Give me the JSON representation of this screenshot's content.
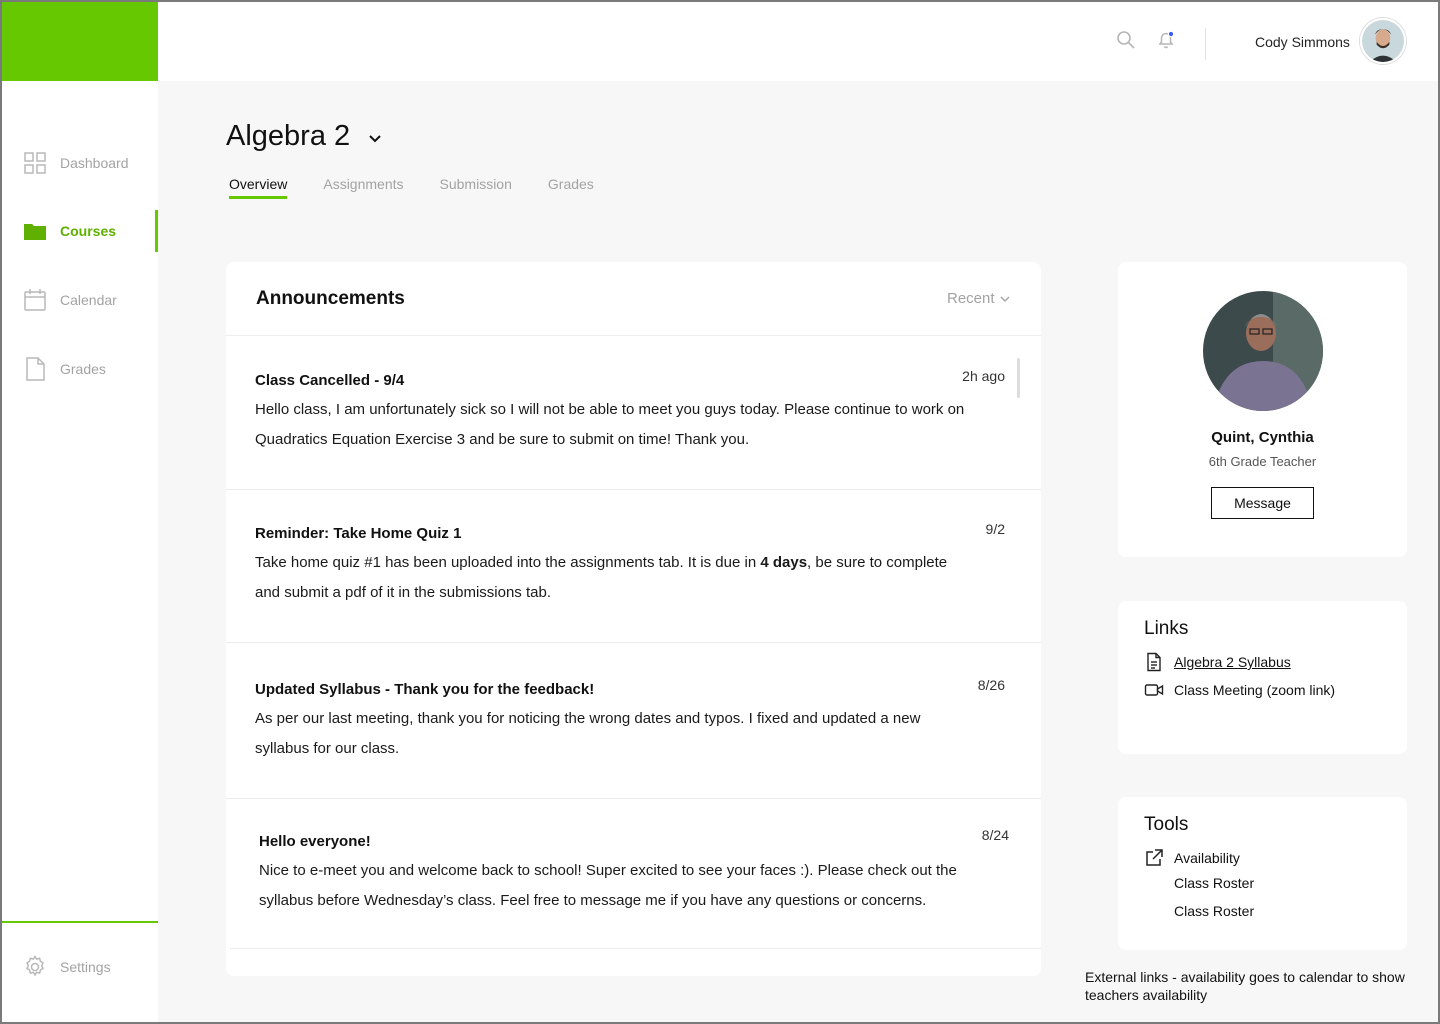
{
  "colors": {
    "accent": "#66c800",
    "active_text": "#5fb000",
    "notification_dot": "#3a5bff"
  },
  "sidebar": {
    "items": [
      {
        "label": "Dashboard",
        "icon": "grid-icon",
        "active": false
      },
      {
        "label": "Courses",
        "icon": "folder-icon",
        "active": true
      },
      {
        "label": "Calendar",
        "icon": "calendar-icon",
        "active": false
      },
      {
        "label": "Grades",
        "icon": "document-icon",
        "active": false
      }
    ],
    "settings": {
      "label": "Settings",
      "icon": "gear-icon"
    }
  },
  "header": {
    "user_name": "Cody Simmons",
    "search_icon": "search-icon",
    "bell_icon": "bell-icon"
  },
  "course": {
    "title": "Algebra 2",
    "tabs": [
      {
        "label": "Overview",
        "active": true
      },
      {
        "label": "Assignments",
        "active": false
      },
      {
        "label": "Submission",
        "active": false
      },
      {
        "label": "Grades",
        "active": false
      }
    ]
  },
  "announcements": {
    "title": "Announcements",
    "sort_label": "Recent",
    "items": [
      {
        "title": "Class Cancelled - 9/4",
        "time": "2h ago",
        "body": "Hello class, I am unfortunately sick so I will not be able to meet you guys today. Please continue to work on Quadratics Equation Exercise 3 and be sure to submit on time! Thank you."
      },
      {
        "title": "Reminder: Take Home Quiz 1",
        "time": "9/2",
        "body_before": "Take home quiz #1 has been uploaded into the assignments tab. It is due in ",
        "body_bold": "4 days",
        "body_after": ", be sure to complete and submit a pdf of it in the submissions tab."
      },
      {
        "title": "Updated Syllabus - Thank you for the feedback!",
        "time": "8/26",
        "body": "As per our last meeting, thank you for noticing the wrong dates and typos. I fixed and updated a new syllabus for our class."
      },
      {
        "title": "Hello everyone!",
        "time": "8/24",
        "body": "Nice to e-meet you and welcome back to school! Super excited to see your faces :). Please check out the syllabus before Wednesday’s class. Feel free to message me if you have any questions or concerns."
      }
    ]
  },
  "teacher": {
    "name": "Quint, Cynthia",
    "role": "6th Grade Teacher",
    "message_label": "Message"
  },
  "links": {
    "title": "Links",
    "items": [
      {
        "label": "Algebra 2 Syllabus",
        "icon": "file-text-icon",
        "underlined": true
      },
      {
        "label": "Class Meeting (zoom link)",
        "icon": "video-icon",
        "underlined": false
      }
    ]
  },
  "tools": {
    "title": "Tools",
    "items": [
      {
        "label": "Availability",
        "icon": "external-link-icon"
      },
      {
        "label": "Class Roster",
        "icon": ""
      },
      {
        "label": "Class Roster",
        "icon": ""
      }
    ]
  },
  "note": "External links - availability goes to calendar to show teachers availability"
}
